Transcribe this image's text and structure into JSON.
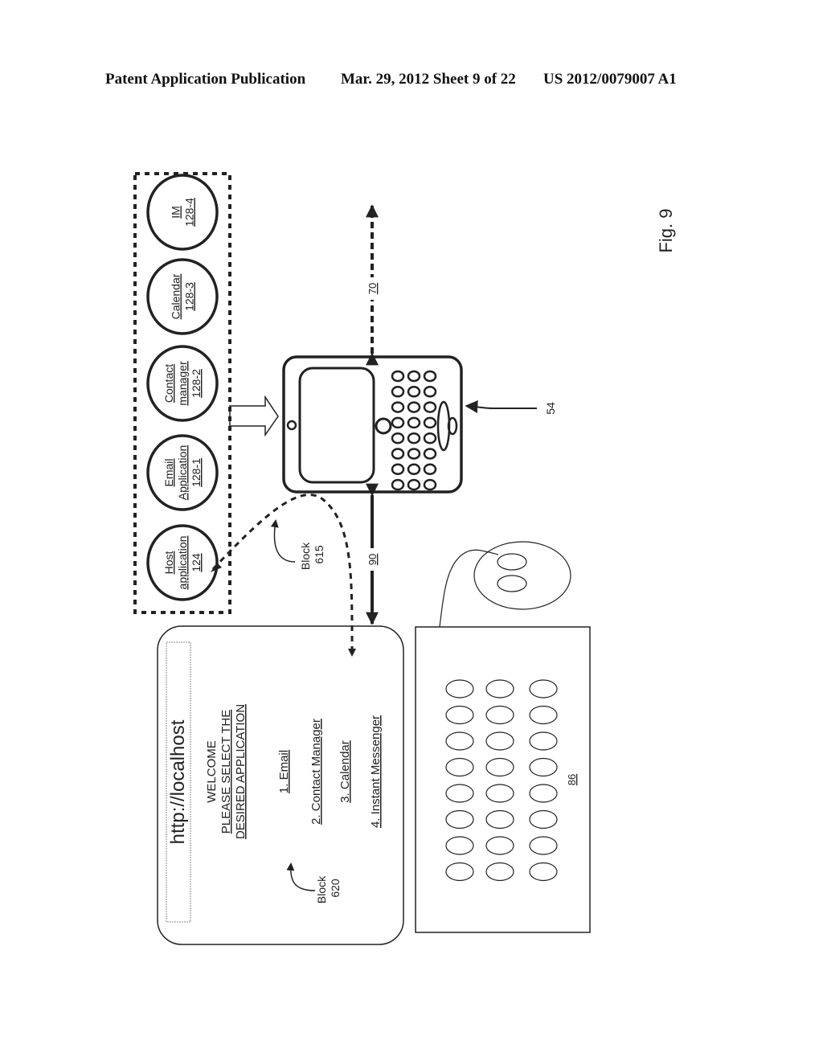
{
  "header": {
    "left": "Patent Application Publication",
    "middle": "Mar. 29, 2012  Sheet 9 of 22",
    "right": "US 2012/0079007 A1"
  },
  "figure": {
    "label": "Fig. 9",
    "applications": [
      {
        "name": "Host application",
        "lines": [
          "Host",
          "application"
        ],
        "ref": "124"
      },
      {
        "name": "Email Application",
        "lines": [
          "Email",
          "Application"
        ],
        "ref": "128-1"
      },
      {
        "name": "Contact manager",
        "lines": [
          "Contact",
          "manager"
        ],
        "ref": "128-2"
      },
      {
        "name": "Calendar",
        "lines": [
          "Calendar"
        ],
        "ref": "128-3"
      },
      {
        "name": "IM",
        "lines": [
          "IM"
        ],
        "ref": "128-4"
      }
    ],
    "device_ref": "54",
    "link_network_ref": "70",
    "link_computer_ref": "90",
    "computer_ref": "86",
    "block_615": {
      "line1": "Block",
      "line2": "615"
    },
    "block_620": {
      "line1": "Block",
      "line2": "620"
    },
    "browser": {
      "url": "http://localhost",
      "welcome": "WELCOME",
      "prompt_line1": "PLEASE SELECT THE",
      "prompt_line2": "DESIRED APPLICATION",
      "menu": [
        "1. Email",
        "2. Contact Manager",
        "3. Calendar",
        "4. Instant Messenger"
      ]
    }
  }
}
